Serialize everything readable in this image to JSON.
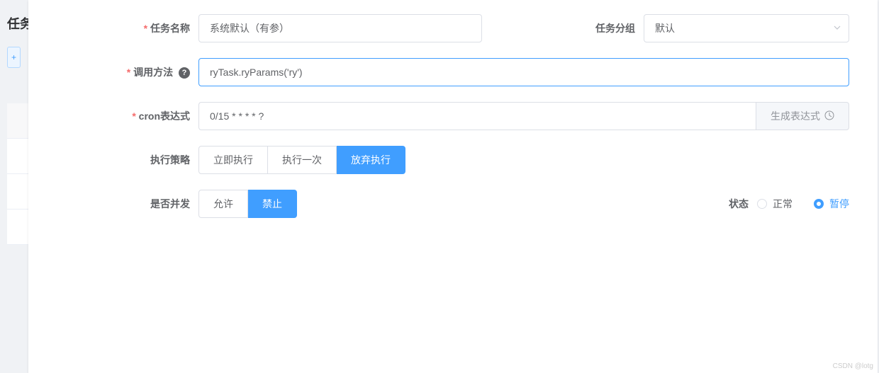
{
  "bg": {
    "title_partial": "任务"
  },
  "form": {
    "task_name": {
      "label": "任务名称",
      "value": "系统默认（有参）"
    },
    "task_group": {
      "label": "任务分组",
      "value": "默认"
    },
    "invoke": {
      "label": "调用方法",
      "value": "ryTask.ryParams('ry')"
    },
    "cron": {
      "label": "cron表达式",
      "value": "0/15 * * * * ?",
      "gen_btn": "生成表达式"
    },
    "policy": {
      "label": "执行策略",
      "options": [
        "立即执行",
        "执行一次",
        "放弃执行"
      ],
      "active": 2
    },
    "concurrent": {
      "label": "是否并发",
      "options": [
        "允许",
        "禁止"
      ],
      "active": 1
    },
    "status": {
      "label": "状态",
      "options": [
        "正常",
        "暂停"
      ],
      "active": 1
    }
  },
  "watermark": "CSDN @lotg"
}
